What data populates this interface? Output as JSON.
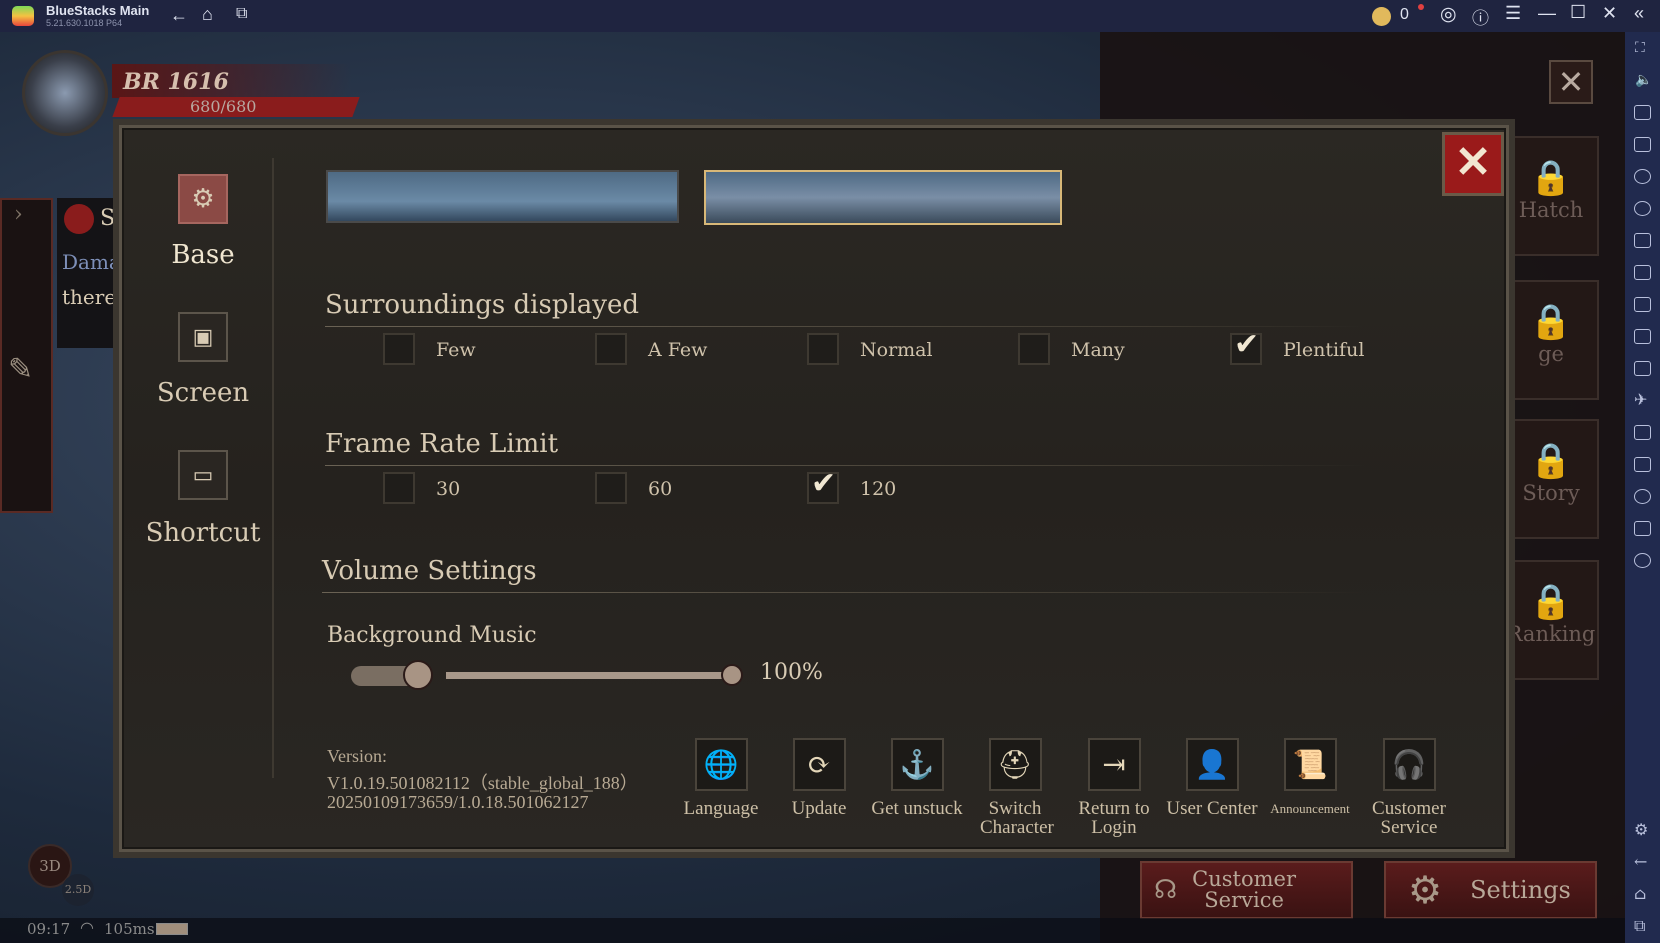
{
  "window": {
    "title": "BlueStacks Main",
    "version": "5.21.630.1018  P64",
    "coins": "0"
  },
  "hud": {
    "br": "BR 1616",
    "hp": "680/680",
    "chat_line1": "S",
    "chat_line2": "Damag",
    "chat_line3": "there's",
    "mode_3d": "3D",
    "mode_25d": "2.5D",
    "time": "09:17",
    "ping": "105ms"
  },
  "right_panels": [
    "Hatch",
    "ge",
    "Story",
    "Ranking"
  ],
  "bottom_buttons": {
    "customer_service": "Customer Service",
    "settings": "Settings"
  },
  "settings": {
    "nav": [
      {
        "label": "Base",
        "active": true
      },
      {
        "label": "Screen"
      },
      {
        "label": "Shortcut"
      }
    ],
    "surroundings": {
      "title": "Surroundings displayed",
      "options": [
        "Few",
        "A Few",
        "Normal",
        "Many",
        "Plentiful"
      ],
      "selected": "Plentiful"
    },
    "frame_rate": {
      "title": "Frame Rate Limit",
      "options": [
        "30",
        "60",
        "120"
      ],
      "selected": "120"
    },
    "volume": {
      "title": "Volume Settings",
      "music_label": "Background Music",
      "music_enabled": true,
      "music_value": "100%",
      "music_percent": 100
    },
    "version": {
      "label": "Version:",
      "line1": "V1.0.19.501082112（stable_global_188）",
      "line2": "20250109173659/1.0.18.501062127"
    },
    "actions": [
      {
        "label": "Language",
        "icon": "language-icon"
      },
      {
        "label": "Update",
        "icon": "refresh-icon"
      },
      {
        "label": "Get unstuck",
        "icon": "anchor-icon"
      },
      {
        "label": "Switch Character",
        "icon": "helmet-icon"
      },
      {
        "label": "Return to Login",
        "icon": "logout-icon"
      },
      {
        "label": "User Center",
        "icon": "user-icon"
      },
      {
        "label": "Announcement",
        "icon": "scroll-icon"
      },
      {
        "label": "Customer Service",
        "icon": "headset-icon"
      }
    ]
  },
  "colors": {
    "titlebar": "#1f2440",
    "sidebar": "#212a4e",
    "panel": "#2b2823",
    "accent_red": "#8b2a2a",
    "text": "#d8cbb4"
  }
}
